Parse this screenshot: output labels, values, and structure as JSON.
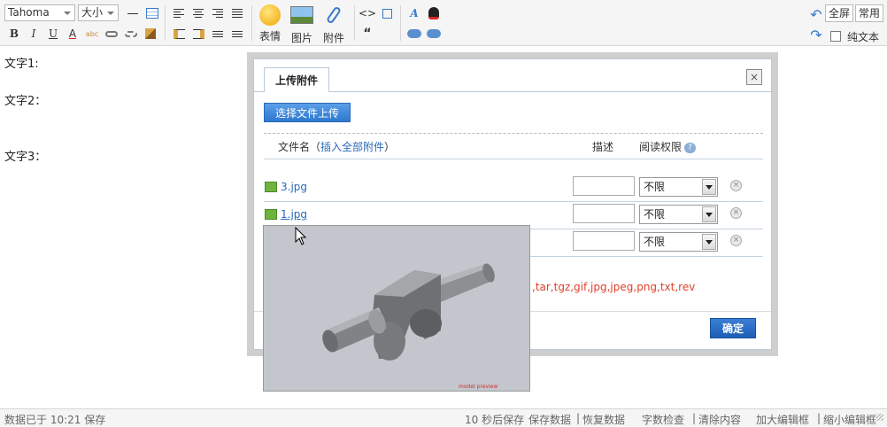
{
  "toolbar": {
    "font_family": "Tahoma",
    "font_size": "大小",
    "big_buttons": {
      "emoji": "表情",
      "image": "图片",
      "attach": "附件"
    },
    "code_label": "<>",
    "quote_label": "“",
    "fullscreen": "全屏",
    "common": "常用",
    "plain_text": "纯文本",
    "bold": "B",
    "italic": "I",
    "underline": "U",
    "font_color": "A",
    "spell": "abc"
  },
  "editor": {
    "lines": [
      "文字1:",
      "文字2：",
      "文字3："
    ]
  },
  "dialog": {
    "tab_label": "上传附件",
    "close_label": "×",
    "upload_button": "选择文件上传",
    "columns": {
      "filename": "文件名（",
      "insert_all": "插入全部附件",
      "filename_end": "）",
      "description": "描述",
      "permission": "阅读权限",
      "help": "?"
    },
    "files": [
      {
        "name": "3.jpg",
        "permission": "不限"
      },
      {
        "name": "1.jpg",
        "permission": "不限"
      },
      {
        "name": "",
        "permission": "不限"
      }
    ],
    "allowed_ext": ",tar,tgz,gif,jpg,jpeg,png,txt,rev",
    "ok_button": "确定",
    "delete_label": "×"
  },
  "preview": {
    "caption": "model preview"
  },
  "statusbar": {
    "left": "数据已于 10:21 保存",
    "autosave": "10 秒后保存",
    "save": "保存数据",
    "restore": "恢复数据",
    "wordcount": "字数检查",
    "clear": "清除内容",
    "enlarge": "加大编辑框",
    "shrink": "缩小编辑框"
  },
  "colors": {
    "accent": "#2a6ab8",
    "warn": "#e0402a"
  }
}
